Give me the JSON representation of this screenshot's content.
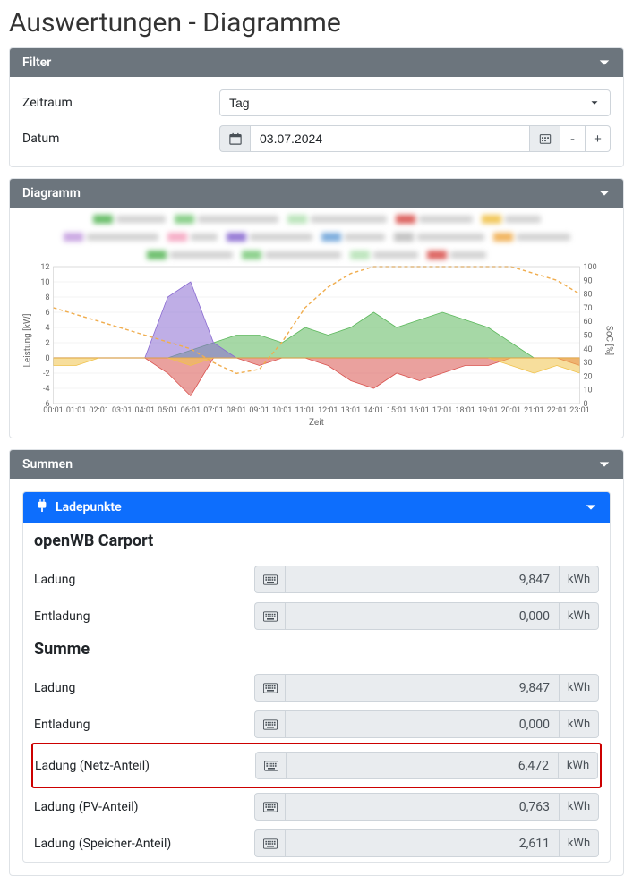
{
  "page_title": "Auswertungen - Diagramme",
  "filter": {
    "header": "Filter",
    "zeitraum_label": "Zeitraum",
    "zeitraum_value": "Tag",
    "datum_label": "Datum",
    "datum_value": "03.07.2024",
    "minus": "-",
    "plus": "+"
  },
  "diagramm": {
    "header": "Diagramm"
  },
  "chart_data": {
    "type": "area",
    "title": "",
    "xlabel": "Zeit",
    "ylabel_left": "Leistung [kW]",
    "ylabel_right": "SoC [%]",
    "ylim_left": [
      -6,
      12
    ],
    "ylim_right": [
      0,
      100
    ],
    "x_ticks": [
      "00:01",
      "01:01",
      "02:01",
      "03:01",
      "04:01",
      "05:01",
      "06:01",
      "07:01",
      "08:01",
      "09:01",
      "10:01",
      "11:01",
      "12:01",
      "13:01",
      "14:01",
      "15:01",
      "16:01",
      "17:01",
      "18:01",
      "19:01",
      "20:01",
      "21:01",
      "22:01",
      "23:01"
    ],
    "series": [
      {
        "name": "SoC",
        "axis": "right",
        "style": "dashed",
        "color": "#f0ad4e",
        "values": [
          70,
          65,
          60,
          55,
          50,
          45,
          40,
          30,
          22,
          25,
          45,
          70,
          85,
          95,
          100,
          100,
          100,
          100,
          100,
          100,
          100,
          95,
          90,
          80
        ]
      },
      {
        "name": "PV",
        "axis": "left",
        "style": "area",
        "color": "#5cb85c",
        "values": [
          0,
          0,
          0,
          0,
          0,
          0,
          1,
          2,
          3,
          3,
          2,
          4,
          3,
          4,
          6,
          4,
          5,
          6,
          5,
          4,
          2,
          0,
          0,
          0
        ]
      },
      {
        "name": "Laden",
        "axis": "left",
        "style": "area",
        "color": "#8a6bd1",
        "values": [
          0,
          0,
          0,
          0,
          0,
          8,
          10,
          2,
          0,
          0,
          0,
          0,
          0,
          0,
          0,
          0,
          0,
          0,
          0,
          0,
          0,
          0,
          0,
          0
        ]
      },
      {
        "name": "Netz",
        "axis": "left",
        "style": "area",
        "color": "#d9534f",
        "values": [
          0,
          0,
          0,
          0,
          0,
          -2,
          -5,
          0,
          0,
          -1,
          0,
          0,
          -1,
          -3,
          -4,
          -2,
          -3,
          -2,
          -1,
          -1,
          0,
          0,
          0,
          -1
        ]
      },
      {
        "name": "Speicher",
        "axis": "left",
        "style": "area",
        "color": "#f0c24b",
        "values": [
          -1,
          -1,
          0,
          0,
          0,
          0,
          -1,
          0,
          0,
          0,
          0,
          0,
          0,
          0,
          0,
          0,
          0,
          0,
          0,
          0,
          -1,
          -2,
          -1,
          -2
        ]
      }
    ]
  },
  "summen": {
    "header": "Summen",
    "ladepunkte_header": "Ladepunkte",
    "group_title": "openWB Carport",
    "summe_title": "Summe",
    "unit": "kWh",
    "group_rows": [
      {
        "label": "Ladung",
        "value": "9,847"
      },
      {
        "label": "Entladung",
        "value": "0,000"
      }
    ],
    "summe_rows": [
      {
        "label": "Ladung",
        "value": "9,847",
        "highlight": false
      },
      {
        "label": "Entladung",
        "value": "0,000",
        "highlight": false
      },
      {
        "label": "Ladung (Netz-Anteil)",
        "value": "6,472",
        "highlight": true
      },
      {
        "label": "Ladung (PV-Anteil)",
        "value": "0,763",
        "highlight": false
      },
      {
        "label": "Ladung (Speicher-Anteil)",
        "value": "2,611",
        "highlight": false
      }
    ]
  },
  "legend_colors": [
    "#5cb85c",
    "#7ecb7e",
    "#b5e2b5",
    "#d9534f",
    "#f0c24b",
    "#c59fe0",
    "#f5a6c1",
    "#8a6bd1",
    "#6fa4d9",
    "#bdbdbd",
    "#f0ad4e"
  ]
}
